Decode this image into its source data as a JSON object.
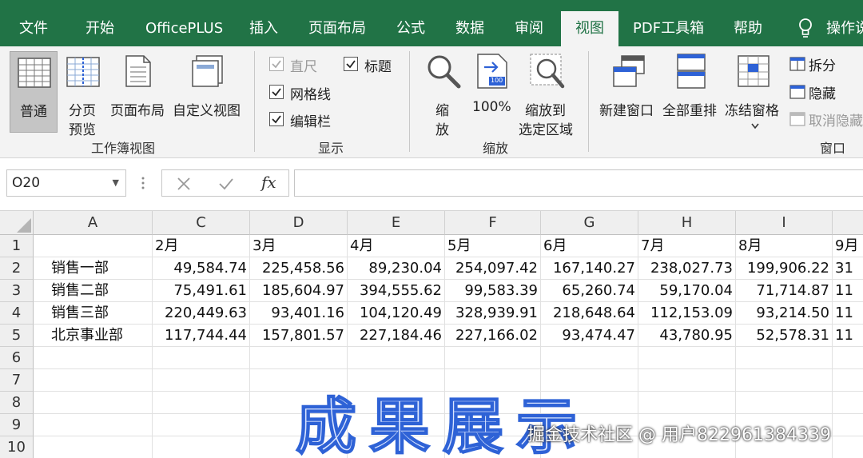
{
  "menubar": {
    "tabs": [
      "文件",
      "开始",
      "OfficePLUS",
      "插入",
      "页面布局",
      "公式",
      "数据",
      "审阅",
      "视图",
      "PDF工具箱",
      "帮助",
      "操作说"
    ],
    "active_tab": "视图",
    "brand_color": "#217346"
  },
  "ribbon": {
    "workbook_views": {
      "normal": "普通",
      "page_break_1": "分页",
      "page_break_2": "预览",
      "page_layout": "页面布局",
      "custom_views": "自定义视图",
      "group_label": "工作簿视图"
    },
    "show": {
      "ruler": "直尺",
      "gridlines": "网格线",
      "formula_bar": "编辑栏",
      "headings": "标题",
      "group_label": "显示"
    },
    "zoom": {
      "zoom_1": "缩",
      "zoom_2": "放",
      "hundred": "100%",
      "zoom_sel_1": "缩放到",
      "zoom_sel_2": "选定区域",
      "hundred_badge": "100",
      "group_label": "缩放"
    },
    "window": {
      "new_window": "新建窗口",
      "arrange_all": "全部重排",
      "freeze_panes": "冻结窗格",
      "split": "拆分",
      "hide": "隐藏",
      "unhide": "取消隐藏",
      "group_label": "窗口"
    }
  },
  "formula_bar": {
    "name_box": "O20",
    "fx": "fx"
  },
  "sheet": {
    "columns": [
      "A",
      "C",
      "D",
      "E",
      "F",
      "G",
      "H",
      "I",
      ""
    ],
    "rows": [
      "1",
      "2",
      "3",
      "4",
      "5",
      "6",
      "7",
      "8",
      "9",
      "10"
    ],
    "header_row": [
      "",
      "2月",
      "3月",
      "4月",
      "5月",
      "6月",
      "7月",
      "8月",
      "9月"
    ],
    "data": [
      [
        "销售一部",
        "49,584.74",
        "225,458.56",
        "89,230.04",
        "254,097.42",
        "167,140.27",
        "238,027.73",
        "199,906.22",
        "31"
      ],
      [
        "销售二部",
        "75,491.61",
        "185,604.97",
        "394,555.62",
        "99,583.39",
        "65,260.74",
        "59,170.04",
        "71,714.87",
        "11"
      ],
      [
        "销售三部",
        "220,449.63",
        "93,401.16",
        "104,120.49",
        "328,939.91",
        "218,648.64",
        "112,153.09",
        "93,214.50",
        "11"
      ],
      [
        "北京事业部",
        "117,744.44",
        "157,801.57",
        "227,184.46",
        "227,166.02",
        "93,474.47",
        "43,780.95",
        "52,578.31",
        "11"
      ]
    ]
  },
  "overlay": {
    "title": "成果展示",
    "watermark": "掘金技术社区 @ 用户822961384339"
  }
}
